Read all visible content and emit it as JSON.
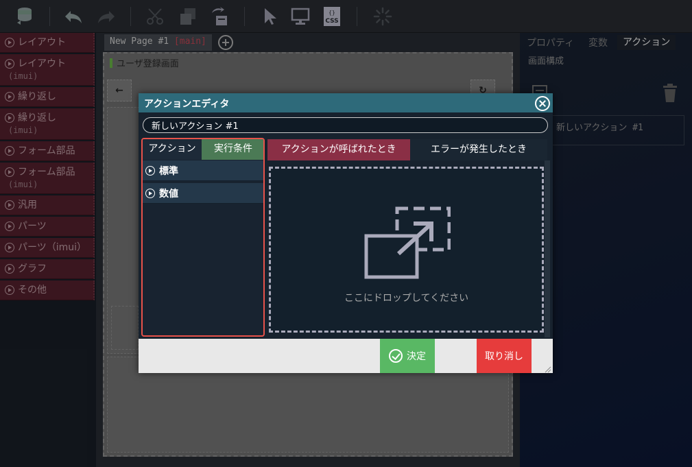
{
  "toolbar": {
    "icons": [
      "database-icon",
      "undo-icon",
      "redo-icon",
      "cut-icon",
      "copy-icon",
      "paste-icon",
      "cursor-icon",
      "monitor-icon",
      "css-icon",
      "spinner-icon"
    ],
    "css_label": "CSS"
  },
  "palette": {
    "items": [
      {
        "label": "レイアウト",
        "sub": ""
      },
      {
        "label": "レイアウト",
        "sub": "(imui)"
      },
      {
        "label": "繰り返し",
        "sub": ""
      },
      {
        "label": "繰り返し",
        "sub": "(imui)"
      },
      {
        "label": "フォーム部品",
        "sub": ""
      },
      {
        "label": "フォーム部品",
        "sub": "(imui)"
      },
      {
        "label": "汎用",
        "sub": ""
      },
      {
        "label": "パーツ",
        "sub": ""
      },
      {
        "label": "パーツ（imui）",
        "sub": ""
      },
      {
        "label": "グラフ",
        "sub": ""
      },
      {
        "label": "その他",
        "sub": ""
      }
    ]
  },
  "canvas": {
    "page_tab": "New Page #1",
    "branch": "[main]",
    "page_title": "ユーザ登録画面"
  },
  "right_panel": {
    "tabs": [
      "プロパティ",
      "変数",
      "アクション"
    ],
    "active_tab": "アクション",
    "subheading": "画面構成",
    "action_item": "新しいアクション #1"
  },
  "dialog": {
    "title": "アクションエディタ",
    "action_name": "新しいアクション #1",
    "left_tabs": {
      "action": "アクション",
      "condition": "実行条件"
    },
    "categories": [
      "標準",
      "数値"
    ],
    "event_tabs": {
      "called": "アクションが呼ばれたとき",
      "error": "エラーが発生したとき"
    },
    "drop_text": "ここにドロップしてください",
    "ok_label": "決定",
    "cancel_label": "取り消し"
  },
  "colors": {
    "title_bar": "#2e6a7a",
    "condition_tab": "#4b7a55",
    "called_tab": "#8a2f45",
    "ok": "#59b864",
    "cancel": "#e63c3c",
    "highlight_border": "#e8524a"
  }
}
